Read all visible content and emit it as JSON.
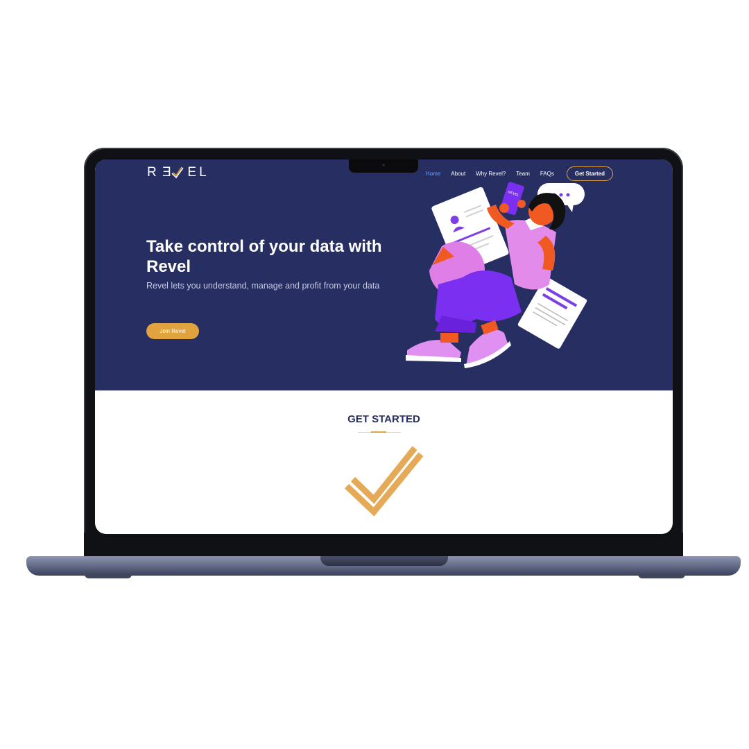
{
  "brand": {
    "logo_letters": [
      "R",
      "E",
      "E",
      "L"
    ],
    "logo_alt": "REVEL",
    "primary_color": "#262e62",
    "accent_color": "#e1a33e"
  },
  "nav": {
    "items": [
      {
        "label": "Home",
        "active": true
      },
      {
        "label": "About",
        "active": false
      },
      {
        "label": "Why Revel?",
        "active": false
      },
      {
        "label": "Team",
        "active": false
      },
      {
        "label": "FAQs",
        "active": false
      }
    ],
    "cta_label": "Get Started"
  },
  "hero": {
    "title": "Take control of your data with Revel",
    "subtitle": "Revel lets you understand, manage and profit from your data",
    "button_label": "Join Revel",
    "phone_text": "REVEL",
    "illustration": "woman-with-phone-illustration"
  },
  "get_started": {
    "title": "GET STARTED",
    "icon": "check-icon"
  }
}
